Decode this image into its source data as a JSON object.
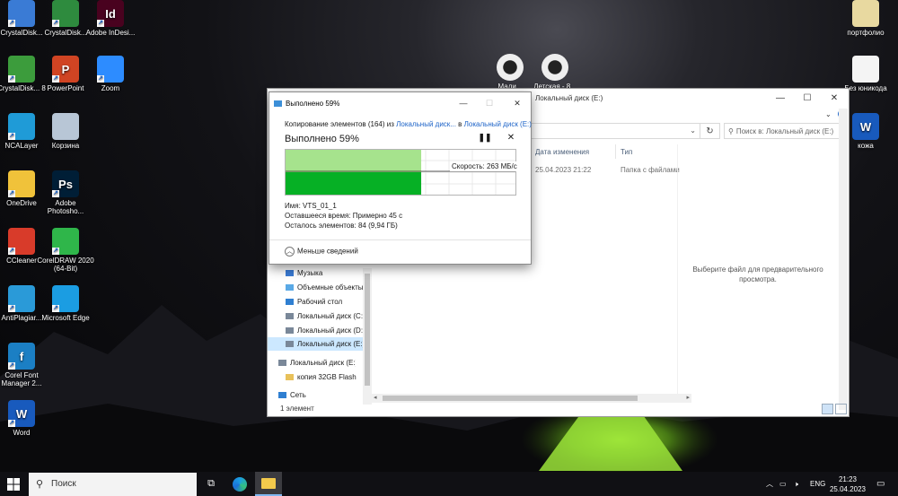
{
  "desktop": {
    "left_icons": [
      {
        "label": "CrystalDisk...",
        "icon": "crystaldisk-icon",
        "color": "#3a7bd5"
      },
      {
        "label": "CrystalDisk...",
        "icon": "spreadsheet-icon",
        "color": "#2e8b3e"
      },
      {
        "label": "Adobe InDesi...",
        "icon": "indesign-icon",
        "color": "#49021f",
        "glyph": "Id"
      },
      {
        "label": "CrystalDisk... 8",
        "icon": "crystaldisk-icon",
        "color": "#3c9c3c"
      },
      {
        "label": "PowerPoint",
        "icon": "powerpoint-icon",
        "color": "#d04423",
        "glyph": "P"
      },
      {
        "label": "Zoom",
        "icon": "zoom-icon",
        "color": "#2d8cff"
      },
      {
        "label": "NCALayer",
        "icon": "ncalayer-icon",
        "color": "#1f9bd7"
      },
      {
        "label": "Корзина",
        "icon": "recycle-bin-icon",
        "color": "#b8c6d6"
      },
      {
        "label": "OneDrive",
        "icon": "onedrive-icon",
        "color": "#f0c23a"
      },
      {
        "label": "Adobe Photosho...",
        "icon": "photoshop-icon",
        "color": "#001e36",
        "glyph": "Ps"
      },
      {
        "label": "CCleaner",
        "icon": "ccleaner-icon",
        "color": "#d83b2a"
      },
      {
        "label": "CorelDRAW 2020 (64-Bit)",
        "icon": "coreldraw-icon",
        "color": "#2fb64a"
      },
      {
        "label": "AntiPlagiar...",
        "icon": "antiplagiat-icon",
        "color": "#2a9ad8"
      },
      {
        "label": "Microsoft Edge",
        "icon": "edge-icon",
        "color": "#1b9de2"
      },
      {
        "label": "Corel Font Manager 2...",
        "icon": "corel-font-icon",
        "color": "#1b7fc4",
        "glyph": "f"
      },
      {
        "label": "Word",
        "icon": "word-icon",
        "color": "#185abd",
        "glyph": "W"
      }
    ],
    "right_icons": [
      {
        "label": "портфолио",
        "icon": "folder-document-icon",
        "color": "#e8d9a0"
      },
      {
        "label": "Без юникода",
        "icon": "text-file-icon",
        "color": "#f4f4f4"
      },
      {
        "label": "кожа",
        "icon": "word-icon",
        "color": "#185abd",
        "glyph": "W"
      }
    ],
    "center_icons": [
      {
        "label": "Мали...",
        "icon": "video-file-icon",
        "color": "#e6e6e6"
      },
      {
        "label": "Детская - 8...",
        "icon": "video-file-icon",
        "color": "#e6e6e6"
      }
    ]
  },
  "explorer": {
    "title": "Локальный диск (E:)",
    "search_placeholder": "Поиск в: Локальный диск (E:)",
    "columns": {
      "date": "Дата изменения",
      "type": "Тип"
    },
    "row": {
      "date": "25.04.2023 21:22",
      "type": "Папка с файлами"
    },
    "preview_text": "Выберите файл для предварительного просмотра.",
    "nav": [
      {
        "label": "Музыка",
        "icon": "music-icon",
        "color": "#3a7bd5"
      },
      {
        "label": "Объемные объекты",
        "icon": "3d-objects-icon",
        "color": "#5aa9e6"
      },
      {
        "label": "Рабочий стол",
        "icon": "desktop-icon",
        "color": "#2f7fd1"
      },
      {
        "label": "Локальный диск (C:)",
        "icon": "drive-icon",
        "color": "#7a8899"
      },
      {
        "label": "Локальный диск (D:)",
        "icon": "drive-icon",
        "color": "#7a8899"
      },
      {
        "label": "Локальный диск (E:)",
        "icon": "drive-icon",
        "color": "#7a8899",
        "selected": true
      },
      {
        "label": "Локальный диск (E:)",
        "icon": "drive-icon",
        "color": "#7a8899"
      },
      {
        "label": "копия 32GB Flash",
        "icon": "folder-icon",
        "color": "#e8c15a"
      },
      {
        "label": "Сеть",
        "icon": "network-icon",
        "color": "#2f7fd1"
      }
    ],
    "status": "1 элемент"
  },
  "copy_dialog": {
    "title": "Выполнено 59%",
    "copy_prefix": "Копирование элементов (164) из ",
    "source": "Локальный диск...",
    "middle": " в ",
    "destination": "Локальный диск (E:)",
    "heading": "Выполнено 59%",
    "progress": 0.59,
    "speed": "Скорость: 263 МБ/с",
    "name": "Имя: VTS_01_1",
    "time_left": "Оставшееся время: Примерно 45 с",
    "items_left": "Осталось элементов: 84 (9,94 ГБ)",
    "less_details": "Меньше сведений",
    "accent": "#06b025"
  },
  "taskbar": {
    "search_placeholder": "Поиск",
    "language": "ENG",
    "time": "21:23",
    "date": "25.04.2023"
  }
}
